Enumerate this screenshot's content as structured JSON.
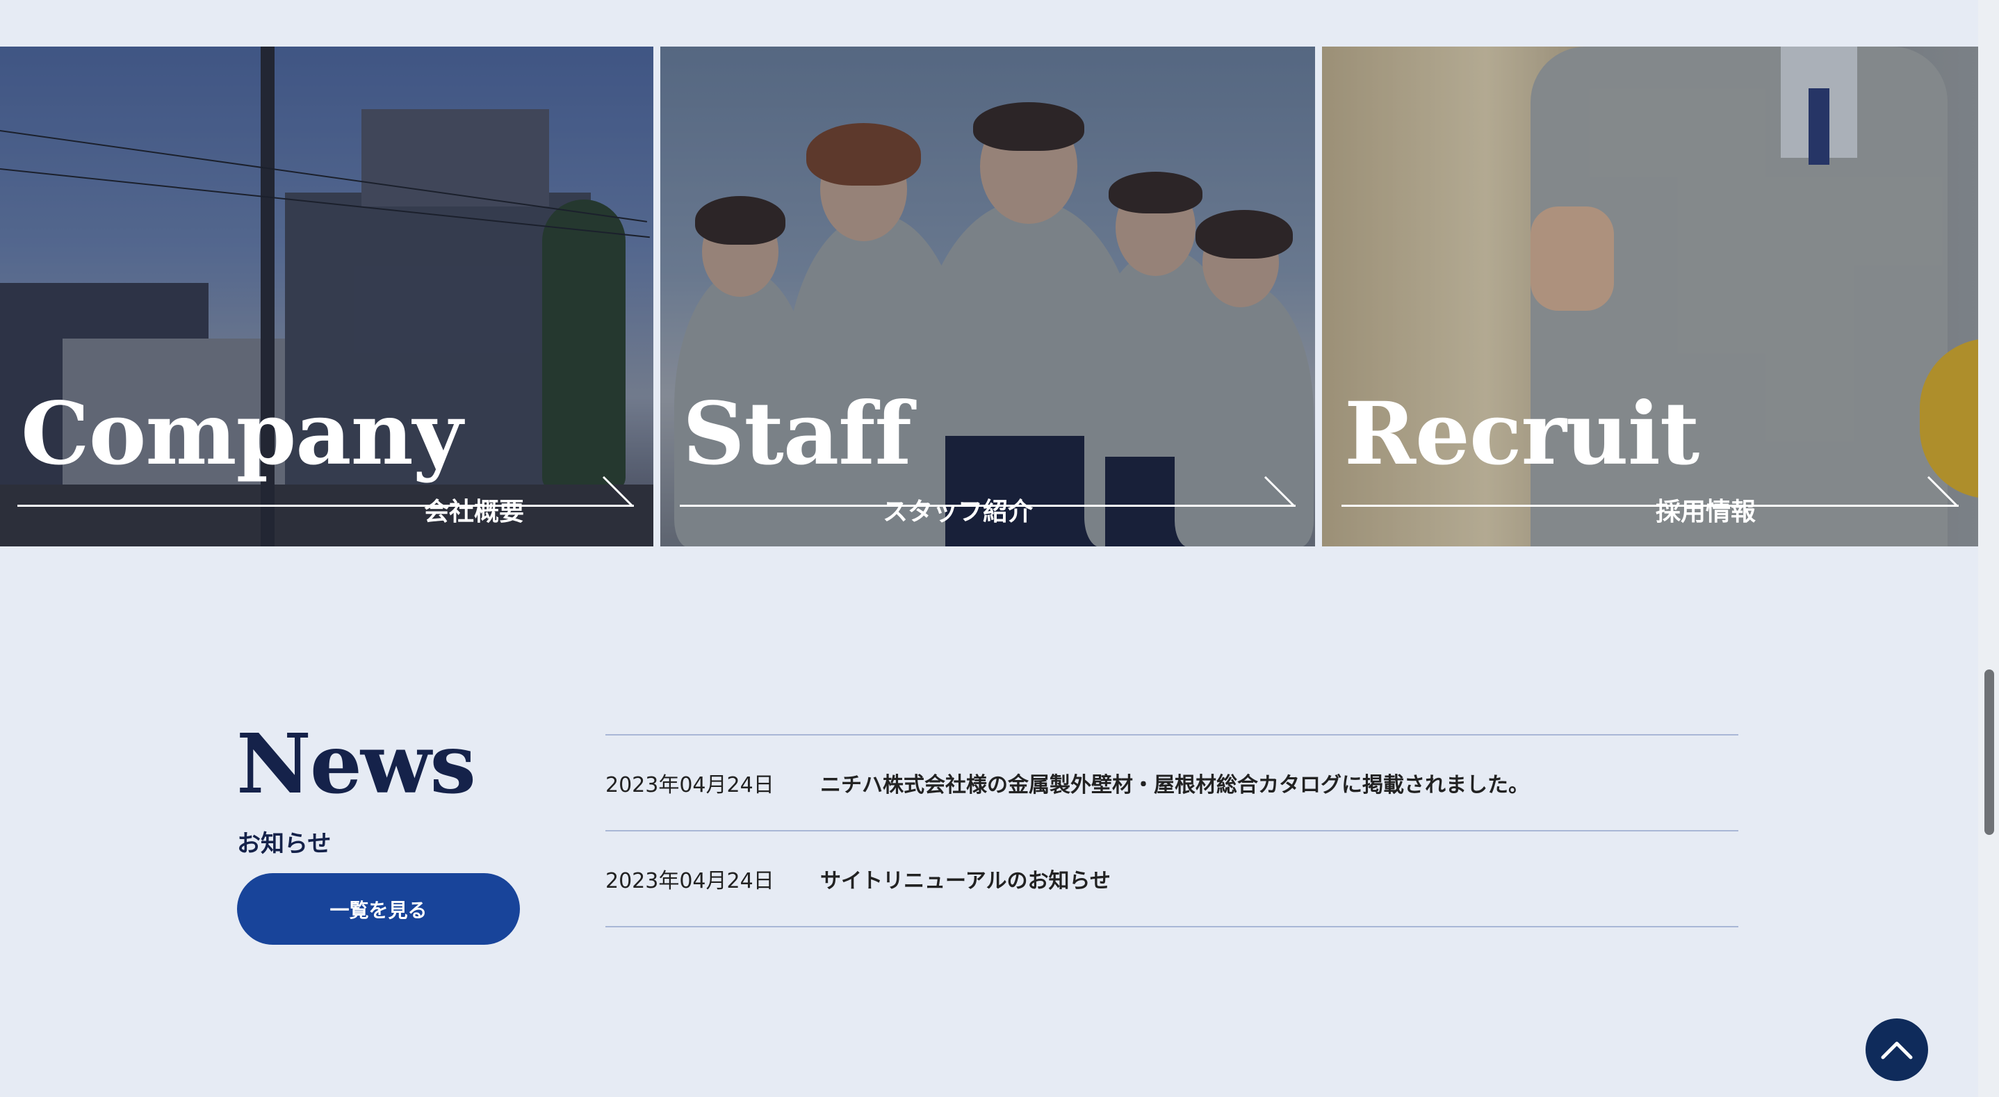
{
  "cards": [
    {
      "title": "Company",
      "subtitle": "会社概要"
    },
    {
      "title": "Staff",
      "subtitle": "スタッフ紹介"
    },
    {
      "title": "Recruit",
      "subtitle": "採用情報"
    }
  ],
  "news": {
    "title": "News",
    "subtitle": "お知らせ",
    "button_label": "一覧を見る",
    "items": [
      {
        "date": "2023年04月24日",
        "text": "ニチハ株式会社様の金属製外壁材・屋根材総合カタログに掲載されました。"
      },
      {
        "date": "2023年04月24日",
        "text": "サイトリニューアルのお知らせ"
      }
    ]
  },
  "icons": {
    "card_arrow": "arrow-right-diagonal-icon",
    "back_to_top": "chevron-up-icon"
  },
  "colors": {
    "background": "#e6ebf4",
    "accent": "#18449a",
    "heading": "#15224a",
    "to_top": "#0f2b5b"
  }
}
